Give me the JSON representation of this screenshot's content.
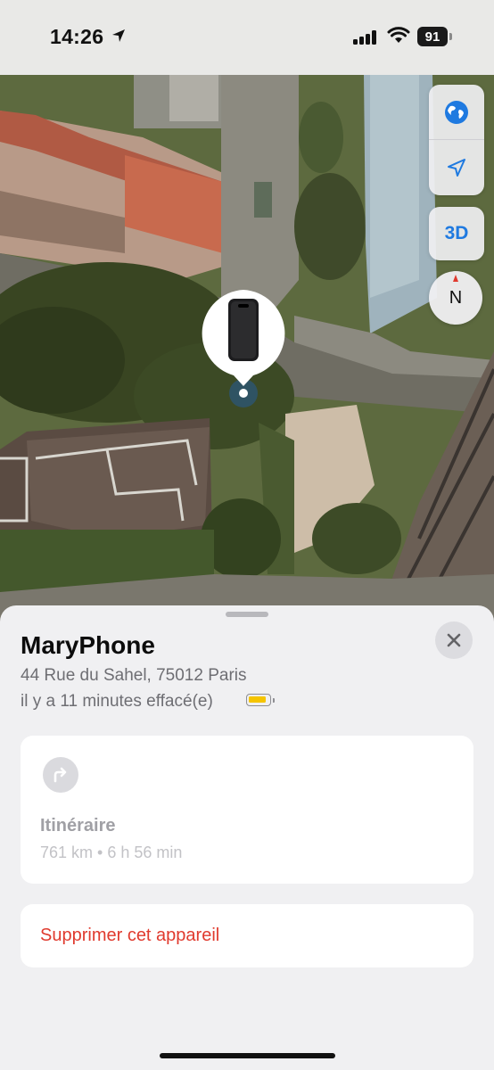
{
  "status_bar": {
    "time": "14:26",
    "battery_level": "91",
    "icons": [
      "location-arrow-icon",
      "cellular-signal-icon",
      "wifi-icon",
      "battery-icon"
    ]
  },
  "map": {
    "controls": {
      "globe_icon": "globe-icon",
      "locate_icon": "location-arrow-icon",
      "three_d_label": "3D",
      "compass_label": "N"
    },
    "pin_icon": "iphone-device-icon"
  },
  "sheet": {
    "device_name": "MaryPhone",
    "address": "44 Rue du Sahel, 75012 Paris",
    "last_seen": "il y a 11 minutes effacé(e)",
    "battery_color": "#f5c400",
    "route": {
      "icon": "turn-right-arrow-icon",
      "title": "Itinéraire",
      "detail": "761 km • 6 h 56 min"
    },
    "remove_label": "Supprimer cet appareil",
    "remove_color": "#e03a2e"
  }
}
